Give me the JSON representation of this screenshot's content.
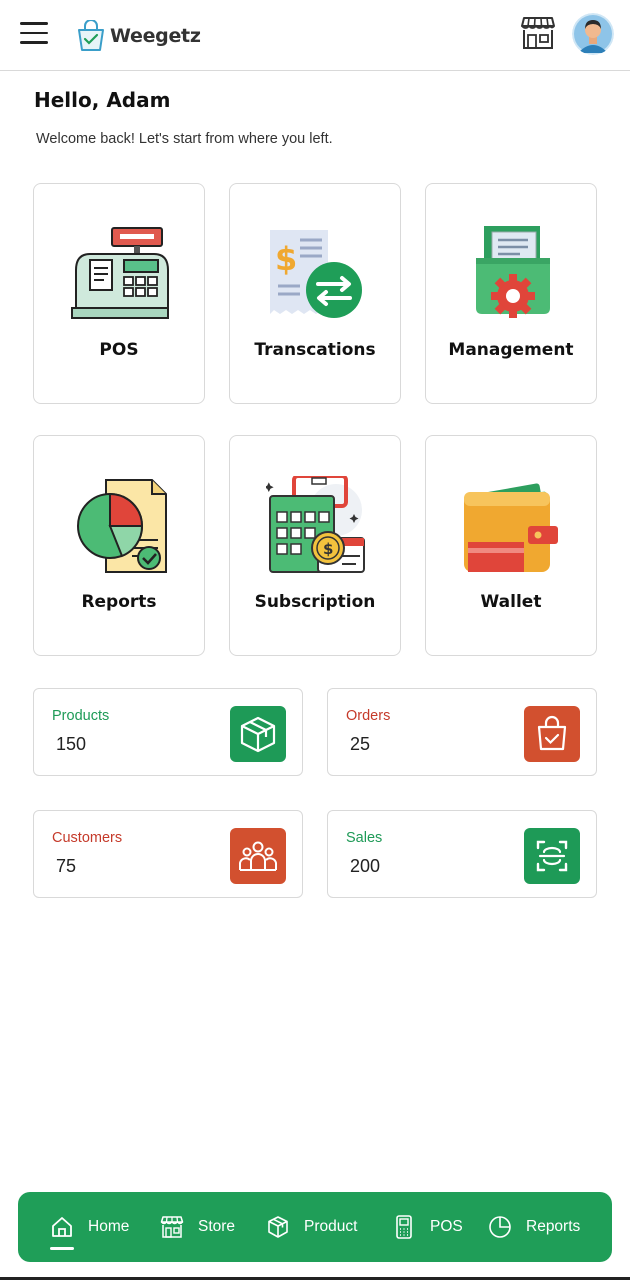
{
  "app": {
    "brand": "Weegetz"
  },
  "greeting": {
    "title": "Hello, Adam",
    "subtitle": "Welcome back! Let's start from where you left."
  },
  "tiles": [
    {
      "label": "POS",
      "icon": "cash-register-icon"
    },
    {
      "label": "Transcations",
      "icon": "transactions-icon"
    },
    {
      "label": "Management",
      "icon": "management-folder-icon"
    },
    {
      "label": "Reports",
      "icon": "reports-chart-icon"
    },
    {
      "label": "Subscription",
      "icon": "subscription-calendar-icon"
    },
    {
      "label": "Wallet",
      "icon": "wallet-icon"
    }
  ],
  "stats": [
    {
      "label": "Products",
      "value": "150",
      "icon": "box-icon",
      "color": "#1e9a57"
    },
    {
      "label": "Orders",
      "value": "25",
      "icon": "shopping-bag-icon",
      "color": "#d2502f"
    },
    {
      "label": "Customers",
      "value": "75",
      "icon": "users-icon",
      "color": "#d2502f"
    },
    {
      "label": "Sales",
      "value": "200",
      "icon": "scan-icon",
      "color": "#1e9a57"
    }
  ],
  "nav": [
    {
      "label": "Home",
      "icon": "home-icon",
      "active": true
    },
    {
      "label": "Store",
      "icon": "store-icon"
    },
    {
      "label": "Product",
      "icon": "cube-icon"
    },
    {
      "label": "POS",
      "icon": "pos-terminal-icon"
    },
    {
      "label": "Reports",
      "icon": "pie-chart-icon"
    }
  ],
  "colors": {
    "accent": "#1f9e58",
    "danger": "#d2502f",
    "border": "#d9d9d9"
  }
}
